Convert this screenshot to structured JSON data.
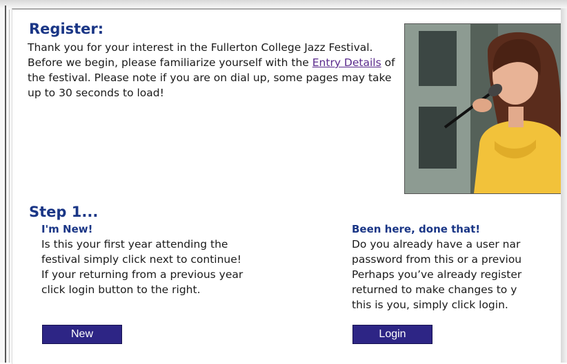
{
  "register": {
    "title": "Register:",
    "intro_part1": "Thank you for your interest in the Fullerton College Jazz Festival. Before we begin, please familiarize yourself with the ",
    "link": "Entry Details",
    "intro_part2": " of the festival. Please note if you are on dial up, some pages may take up to 30 seconds to load!"
  },
  "step": {
    "title": "Step 1...",
    "new": {
      "heading": "I'm New!",
      "line1": "Is this your first year attending the",
      "line2": "festival simply click next to continue!",
      "line3": "If your returning from a previous year",
      "line4": "click login button to the right.",
      "button": "New"
    },
    "returning": {
      "heading": "Been here, done that!",
      "line1": "Do you already have a user nar",
      "line2": "password from this or a previou",
      "line3": "Perhaps you’ve already register",
      "line4": "returned to make changes to y",
      "line5": "this is you, simply click login.",
      "button": "Login"
    }
  },
  "colors": {
    "heading": "#1a3686",
    "button": "#2d2585",
    "link": "#5a2a8c"
  }
}
